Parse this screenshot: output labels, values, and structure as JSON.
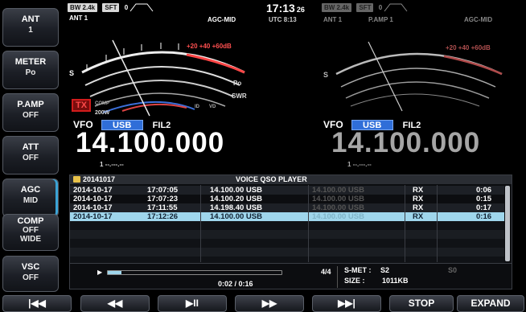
{
  "side_buttons": [
    {
      "title": "ANT",
      "value": "1"
    },
    {
      "title": "METER",
      "value": "Po"
    },
    {
      "title": "P.AMP",
      "value": "OFF"
    },
    {
      "title": "ATT",
      "value": "OFF"
    },
    {
      "title": "AGC",
      "value": "MID"
    },
    {
      "title": "COMP",
      "value": "OFF",
      "value2": "WIDE"
    },
    {
      "title": "VSC",
      "value": "OFF"
    }
  ],
  "left_header": {
    "bw": "BW 2.4k",
    "sft": "SFT",
    "sft_val": "0",
    "ant": "ANT 1",
    "agc": "AGC-MID"
  },
  "clock": {
    "time": "17:13",
    "sec": "26",
    "utc": "UTC",
    "utc_time": "8:13"
  },
  "right_header": {
    "bw": "BW 2.4k",
    "sft": "SFT",
    "sft_val": "0",
    "ant": "ANT 1",
    "pamp": "P.AMP 1",
    "agc": "AGC-MID"
  },
  "meter_left": {
    "scale_top": "+20   +40   +60dB",
    "s_label": "S",
    "po_label": "Po",
    "swr_label": "SWR",
    "comp_label": "COMP",
    "id_label": "ID",
    "vd_label": "VD",
    "power": "200W"
  },
  "tx_badge": "TX",
  "vfo_main": {
    "label": "VFO",
    "mode": "USB",
    "filter": "FIL2",
    "freq": "14.100.000",
    "sub": "1 --.---.--"
  },
  "vfo_sub": {
    "label": "VFO",
    "mode": "USB",
    "filter": "FIL2",
    "freq": "14.100.000",
    "sub": "1 --.---.--"
  },
  "player": {
    "folder": "20141017",
    "title": "VOICE QSO PLAYER",
    "rows": [
      {
        "date": "2014-10-17",
        "time": "17:07:05",
        "freq": "14.100.00 USB",
        "sub": "14.100.00 USB",
        "dir": "RX",
        "dur": "0:06"
      },
      {
        "date": "2014-10-17",
        "time": "17:07:23",
        "freq": "14.100.20 USB",
        "sub": "14.100.00 USB",
        "dir": "RX",
        "dur": "0:15"
      },
      {
        "date": "2014-10-17",
        "time": "17:11:55",
        "freq": "14.198.40 USB",
        "sub": "14.100.00 USB",
        "dir": "RX",
        "dur": "0:17"
      },
      {
        "date": "2014-10-17",
        "time": "17:12:26",
        "freq": "14.100.00 USB",
        "sub": "14.100.00 USB",
        "dir": "RX",
        "dur": "0:16"
      }
    ],
    "progress": 0.08,
    "time_pos": "0:02 / 0:16",
    "count": "4/4",
    "smet_label": "S-MET :",
    "smet": "S2",
    "smet_right": "S0",
    "size_label": "SIZE :",
    "size": "1011KB"
  },
  "bottom": [
    "|◀◀",
    "◀◀",
    "▶II",
    "▶▶",
    "▶▶|",
    "STOP",
    "EXPAND"
  ],
  "colors": {
    "accent": "#3aa3d6",
    "select": "#9fd6ec",
    "mode": "#2f6ed8",
    "tx": "#d21c1c"
  }
}
